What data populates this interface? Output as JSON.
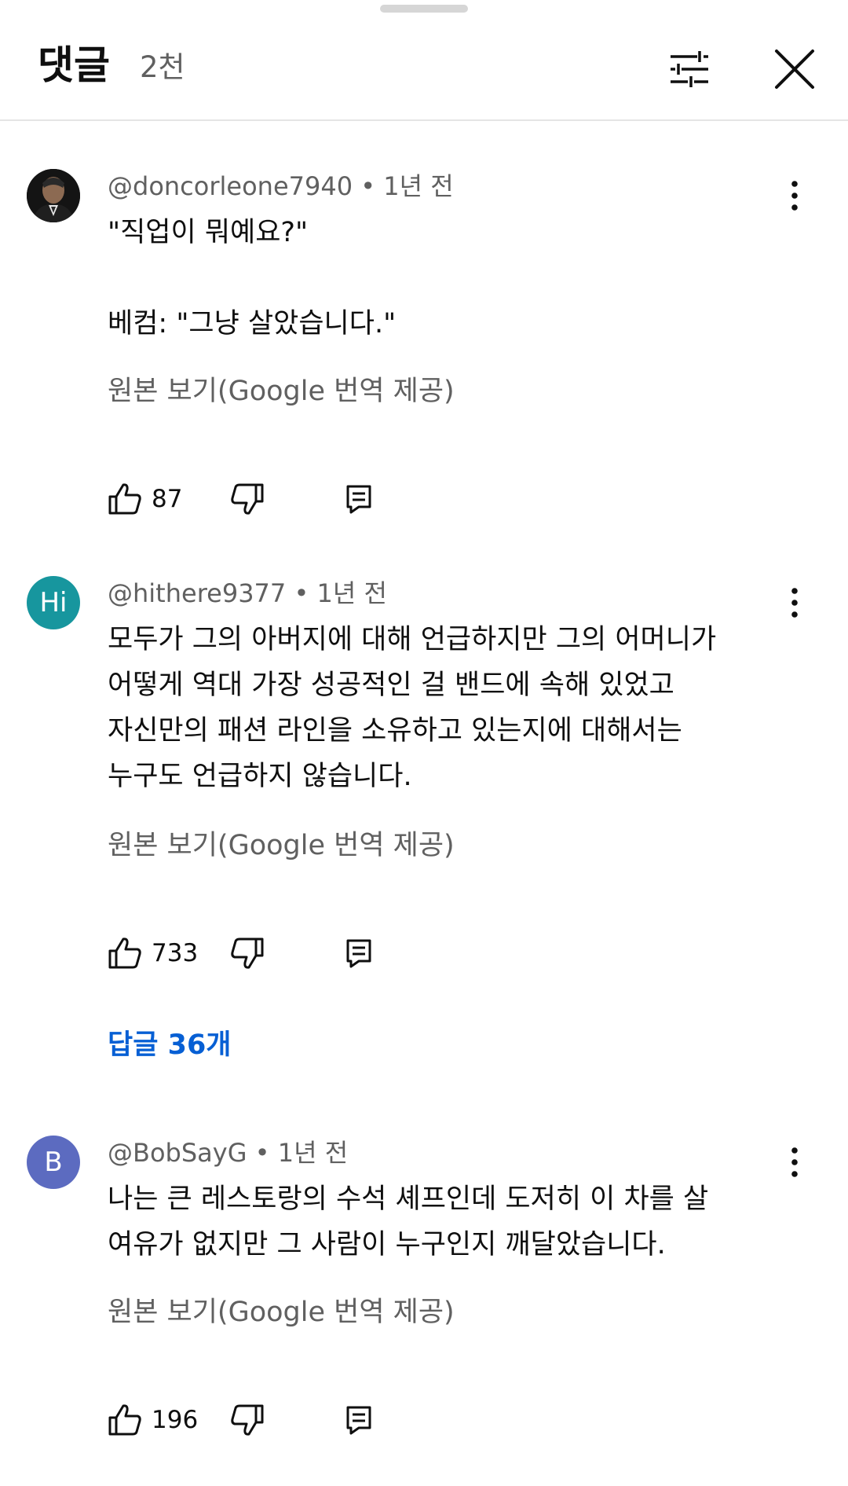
{
  "header": {
    "title": "댓글",
    "count": "2천",
    "filter_icon": "sliders-icon",
    "close_icon": "close-icon"
  },
  "comments": [
    {
      "author": "@doncorleone7940",
      "time": "1년 전",
      "avatar_type": "photo",
      "avatar_letter": "",
      "lines": [
        "\"직업이 뭐예요?\"",
        "",
        "베컴: \"그냥 살았습니다.\""
      ],
      "translate_label": "원본 보기(Google 번역 제공)",
      "likes": "87"
    },
    {
      "author": "@hithere9377",
      "time": "1년 전",
      "avatar_type": "letter",
      "avatar_letter": "Hi",
      "avatar_color": "#17969e",
      "lines": [
        "모두가 그의 아버지에 대해 언급하지만 그의 어머니가",
        "어떻게 역대 가장 성공적인 걸 밴드에 속해 있었고",
        "자신만의 패션 라인을 소유하고 있는지에 대해서는",
        "누구도 언급하지 않습니다."
      ],
      "translate_label": "원본 보기(Google 번역 제공)",
      "likes": "733",
      "replies_label": "답글 36개"
    },
    {
      "author": "@BobSayG",
      "time": "1년 전",
      "avatar_type": "letter",
      "avatar_letter": "B",
      "avatar_color": "#5c6bc0",
      "lines": [
        "나는 큰 레스토랑의 수석 셰프인데 도저히 이 차를 살",
        "여유가 없지만 그 사람이 누구인지 깨달았습니다."
      ],
      "translate_label": "원본 보기(Google 번역 제공)",
      "likes": "196"
    }
  ],
  "separator": "•",
  "icons": {
    "like": "thumbs-up-icon",
    "dislike": "thumbs-down-icon",
    "reply": "reply-icon",
    "more": "more-vert-icon"
  },
  "colors": {
    "link_blue": "#065fd4",
    "secondary_text": "#606060",
    "primary_text": "#0f0f0f"
  }
}
